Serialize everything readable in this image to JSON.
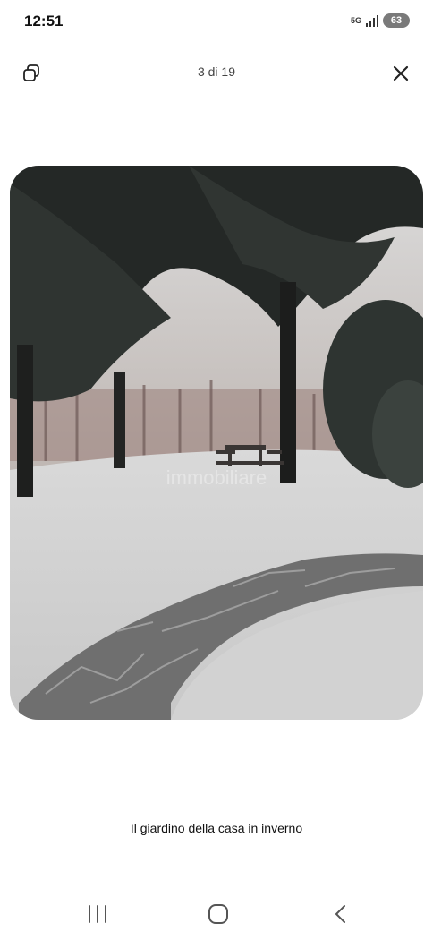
{
  "status_bar": {
    "time": "12:51",
    "network": "5G",
    "battery": "63"
  },
  "viewer": {
    "counter": "3 di 19",
    "caption": "Il giardino della casa in inverno",
    "watermark": "immobiliare"
  },
  "icons": {
    "copy": "copy-icon",
    "close": "close-icon",
    "recent_apps": "recent-apps-icon",
    "home": "home-icon",
    "back": "back-icon"
  },
  "colors": {
    "background": "#ffffff",
    "text": "#111111",
    "battery_pill": "#7a7a7a"
  }
}
